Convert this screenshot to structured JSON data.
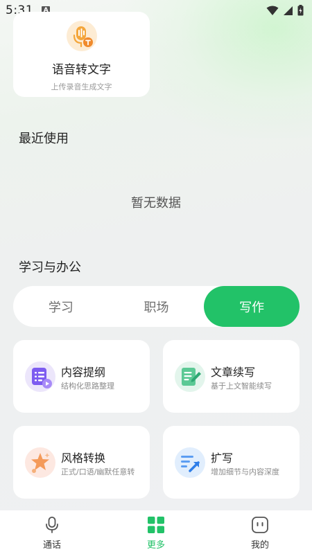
{
  "status_bar": {
    "time": "5:31",
    "notification_letter": "A"
  },
  "voice_card": {
    "title": "语音转文字",
    "subtitle": "上传录音生成文字"
  },
  "recent": {
    "title": "最近使用",
    "empty_text": "暂无数据"
  },
  "study_office": {
    "title": "学习与办公",
    "tabs": [
      {
        "label": "学习",
        "active": false
      },
      {
        "label": "职场",
        "active": false
      },
      {
        "label": "写作",
        "active": true
      }
    ]
  },
  "features": [
    {
      "title": "内容提纲",
      "subtitle": "结构化思路整理"
    },
    {
      "title": "文章续写",
      "subtitle": "基于上文智能续写"
    },
    {
      "title": "风格转换",
      "subtitle": "正式/口语/幽默任意转"
    },
    {
      "title": "扩写",
      "subtitle": "增加细节与内容深度"
    }
  ],
  "bottom_nav": [
    {
      "label": "通话",
      "active": false
    },
    {
      "label": "更多",
      "active": true
    },
    {
      "label": "我的",
      "active": false
    }
  ],
  "colors": {
    "accent": "#22c268",
    "voice_icon": "#f4a63b"
  }
}
